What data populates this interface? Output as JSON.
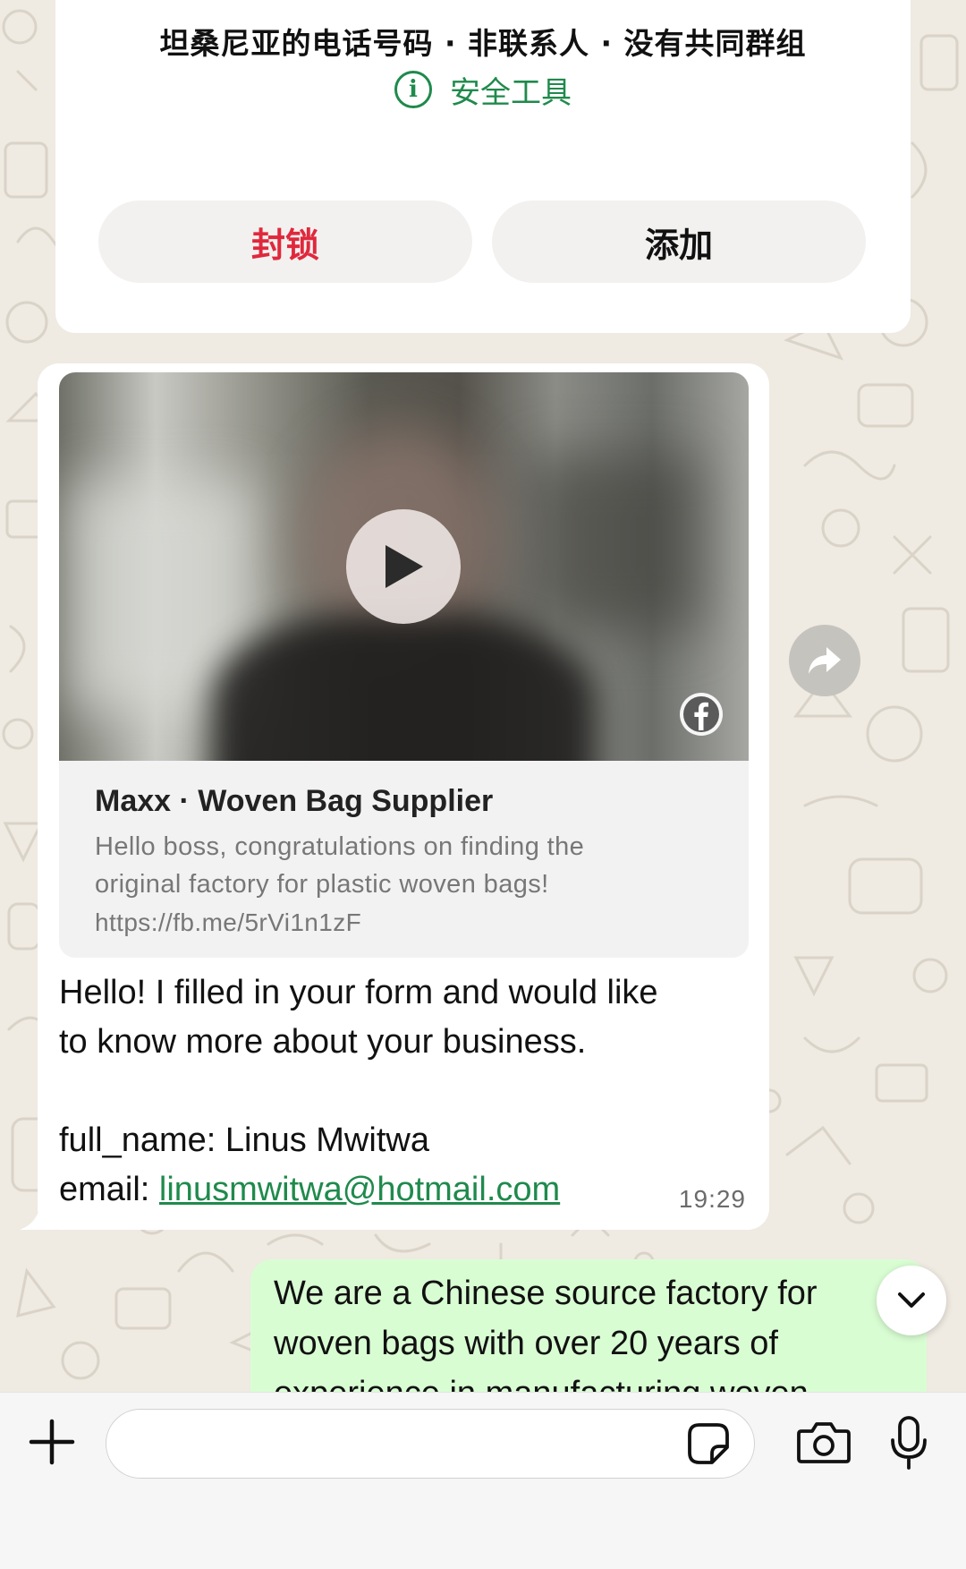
{
  "card": {
    "info_line": "坦桑尼亚的电话号码 · 非联系人 · 没有共同群组",
    "safety_tools_label": "安全工具",
    "block_label": "封锁",
    "add_label": "添加"
  },
  "message_in": {
    "preview": {
      "title": "Maxx · Woven Bag Supplier",
      "desc_line1": "Hello boss, congratulations on finding the",
      "desc_line2": "original factory for plastic woven bags!",
      "url": "https://fb.me/5rVi1n1zF",
      "source_icon": "facebook-icon"
    },
    "line1": "Hello! I filled in your form and would like",
    "line2": "to know more about your business.",
    "full_name": "full_name: Linus Mwitwa",
    "email_prefix": "email: ",
    "email": "linusmwitwa@hotmail.com",
    "time": "19:29"
  },
  "message_out": {
    "line1": "We are a Chinese source factory for",
    "line2": "woven bags with over 20 years of",
    "line3": "experience in manufacturing woven"
  },
  "composer": {
    "input_value": "",
    "icons": [
      "plus-icon",
      "sticker-icon",
      "camera-icon",
      "microphone-icon"
    ]
  },
  "colors": {
    "accent_green": "#1f8a4c",
    "block_red": "#e0283c",
    "outgoing_bubble": "#d9fdd3",
    "chat_background": "#efeae2"
  }
}
